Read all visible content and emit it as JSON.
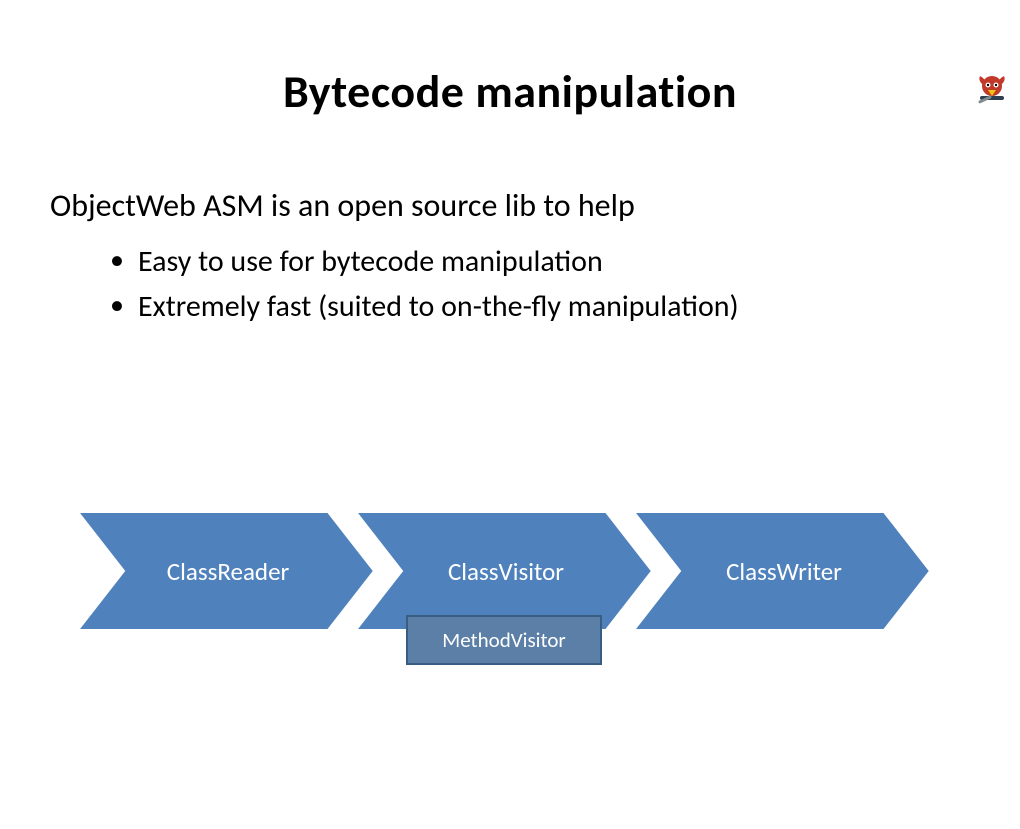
{
  "title": "Bytecode manipulation",
  "lead": "ObjectWeb ASM is an open source lib to help",
  "bullets": [
    "Easy to use for bytecode manipulation",
    "Extremely fast (suited to on-the-fly manipulation)"
  ],
  "diagram": {
    "steps": [
      "ClassReader",
      "ClassVisitor",
      "ClassWriter"
    ],
    "subStep": "MethodVisitor",
    "colors": {
      "chevronFill": "#4f81bd",
      "chevronStroke": "#ffffff",
      "subFill": "#5b7fa6",
      "subBorder": "#385d83"
    }
  }
}
